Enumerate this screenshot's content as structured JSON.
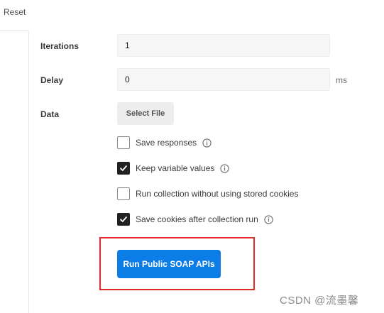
{
  "header": {
    "reset_label": "Reset"
  },
  "form": {
    "iterations": {
      "label": "Iterations",
      "value": "1"
    },
    "delay": {
      "label": "Delay",
      "value": "0",
      "unit": "ms"
    },
    "data": {
      "label": "Data",
      "button_label": "Select File"
    }
  },
  "options": [
    {
      "label": "Save responses",
      "checked": false,
      "info_icon": "info-icon"
    },
    {
      "label": "Keep variable values",
      "checked": true,
      "info_icon": "info-icon"
    },
    {
      "label": "Run collection without using stored cookies",
      "checked": false
    },
    {
      "label": "Save cookies after collection run",
      "checked": true,
      "info_icon": "info-icon"
    }
  ],
  "run_button": {
    "label": "Run Public SOAP APIs"
  },
  "watermark": {
    "text": "CSDN @流墨馨"
  },
  "colors": {
    "primary": "#0c7ce6",
    "highlight": "#e12a2a",
    "checkbox_checked": "#212121"
  }
}
